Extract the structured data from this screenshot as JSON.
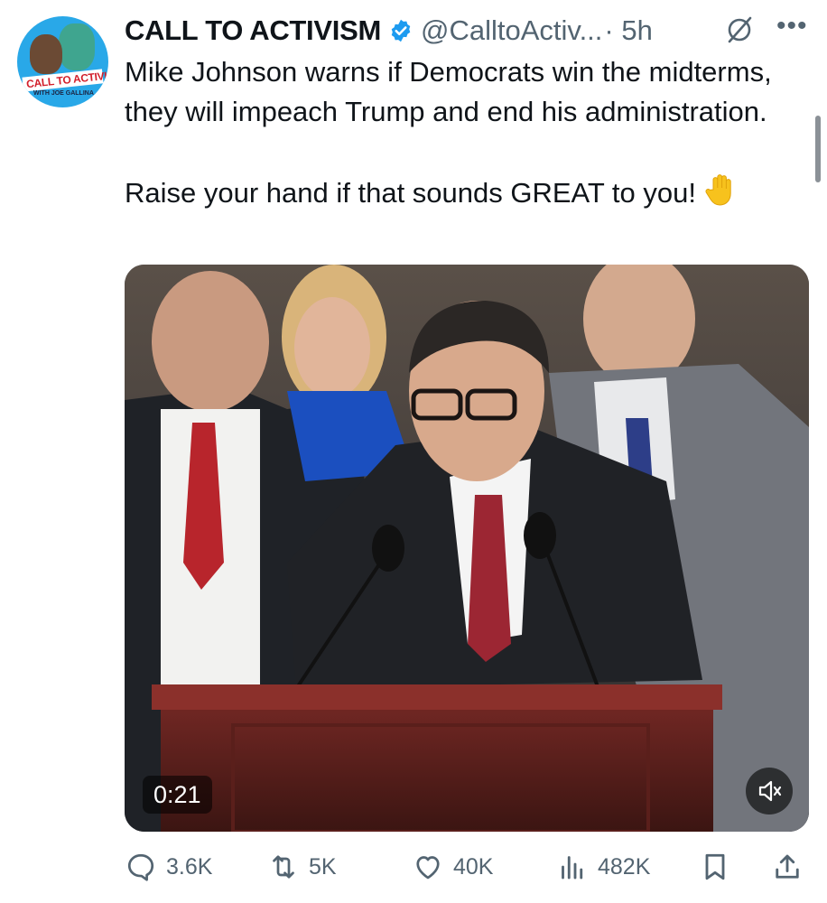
{
  "account": {
    "display_name": "CALL TO ACTIVISM",
    "handle": "@CalltoActiv...",
    "time": "· 5h",
    "avatar_banner": "CALL TO ACTIVISM",
    "avatar_sub": "WITH JOE GALLINA",
    "verified_icon": "verified-badge-icon",
    "accent_color": "#1d9bf0"
  },
  "tweet": {
    "line1": "Mike Johnson warns if Democrats win the midterms, they will impeach Trump and end his administration.",
    "line2": "Raise your hand if that sounds GREAT to you!",
    "emoji": "✋"
  },
  "media": {
    "duration": "0:21",
    "mute_icon": "speaker-muted-icon"
  },
  "actions": {
    "replies": "3.6K",
    "reposts": "5K",
    "likes": "40K",
    "views": "482K"
  },
  "icons": [
    "reply-icon",
    "repost-icon",
    "like-icon",
    "views-icon",
    "bookmark-icon",
    "share-icon",
    "grok-icon",
    "more-icon"
  ]
}
